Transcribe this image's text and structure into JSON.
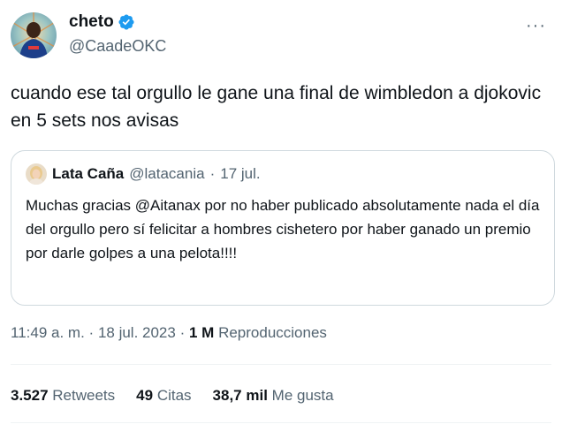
{
  "author": {
    "display_name": "cheto",
    "handle": "@CaadeOKC",
    "verified_icon": "verified-badge-icon",
    "verified_color": "#1d9bf0"
  },
  "more_icon": "···",
  "tweet": {
    "text": "cuando ese tal orgullo le gane una final de wimbledon a djokovic en 5 sets nos avisas"
  },
  "quoted": {
    "display_name": "Lata Caña",
    "handle": "@latacania",
    "separator": "·",
    "date": "17 jul.",
    "text": "Muchas gracias @Aitanax por no haber publicado absolutamente nada el día del orgullo pero sí felicitar a hombres cishetero por haber ganado un premio por darle golpes a una pelota!!!!"
  },
  "meta": {
    "time": "11:49 a. m.",
    "sep1": "·",
    "date": "18 jul. 2023",
    "sep2": "·",
    "views_count": "1 M",
    "views_label": "Reproducciones"
  },
  "stats": {
    "retweets_count": "3.527",
    "retweets_label": "Retweets",
    "quotes_count": "49",
    "quotes_label": "Citas",
    "likes_count": "38,7 mil",
    "likes_label": "Me gusta"
  }
}
